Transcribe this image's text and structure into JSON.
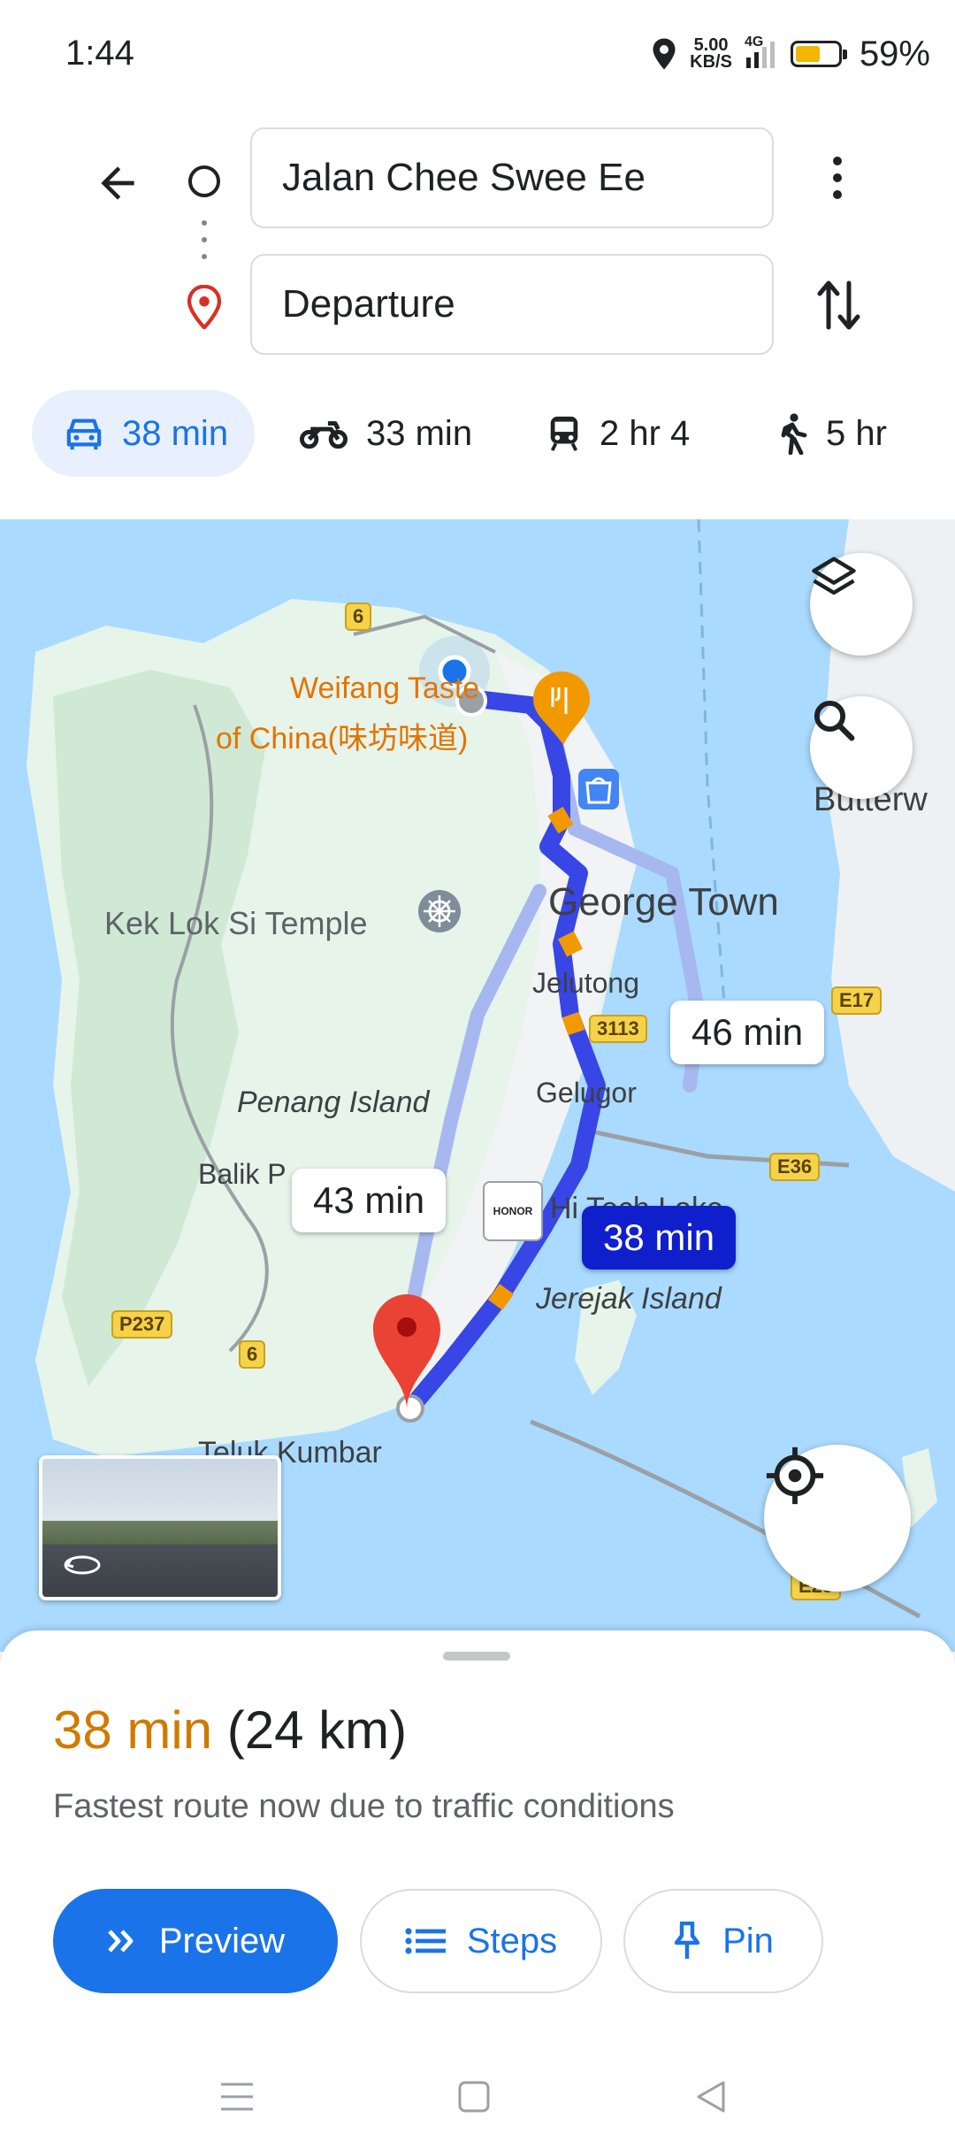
{
  "status_bar": {
    "time": "1:44",
    "net_speed_value": "5.00",
    "net_speed_unit": "KB/S",
    "network": "4G",
    "battery_level": 0.59,
    "battery_text": "59%"
  },
  "directions": {
    "origin": "Jalan Chee Swee Ee",
    "destination": "Departure"
  },
  "modes": [
    {
      "icon": "car-icon",
      "label": "38 min",
      "selected": true
    },
    {
      "icon": "motorcycle-icon",
      "label": "33 min"
    },
    {
      "icon": "train-icon",
      "label": "2 hr 4"
    },
    {
      "icon": "walking-icon",
      "label": "5 hr"
    }
  ],
  "map": {
    "labels": {
      "restaurant_line1": "Weifang Taste",
      "restaurant_line2": "of China(味坊味道)",
      "temple": "Kek Lok Si Temple",
      "george_town": "George Town",
      "butterworth": "Butterw",
      "jelutong": "Jelutong",
      "gelugor": "Gelugor",
      "penang_island": "Penang Island",
      "balik_pulau": "Balik P",
      "bayan_lepas": "Hi Tech Lake",
      "jerejak": "Jerejak Island",
      "teluk_kumbar": "Teluk Kumbar"
    },
    "shields": {
      "r6_top": "6",
      "r3113": "3113",
      "e17": "E17",
      "e36": "E36",
      "p237": "P237",
      "r6_bottom": "6",
      "e28": "E28"
    },
    "routes": {
      "alt_right": "46 min",
      "alt_left": "43 min",
      "selected": "38 min"
    },
    "honor_badge": "HONOR"
  },
  "sheet": {
    "duration": "38 min",
    "distance": "(24 km)",
    "description": "Fastest route now due to traffic conditions",
    "preview_label": "Preview",
    "steps_label": "Steps",
    "pin_label": "Pin"
  },
  "colors": {
    "accent": "#1a73e8",
    "route_selected": "#1a2be8",
    "duration": "#d17a00",
    "water": "#aadaff",
    "land": "#e6f4ea"
  }
}
